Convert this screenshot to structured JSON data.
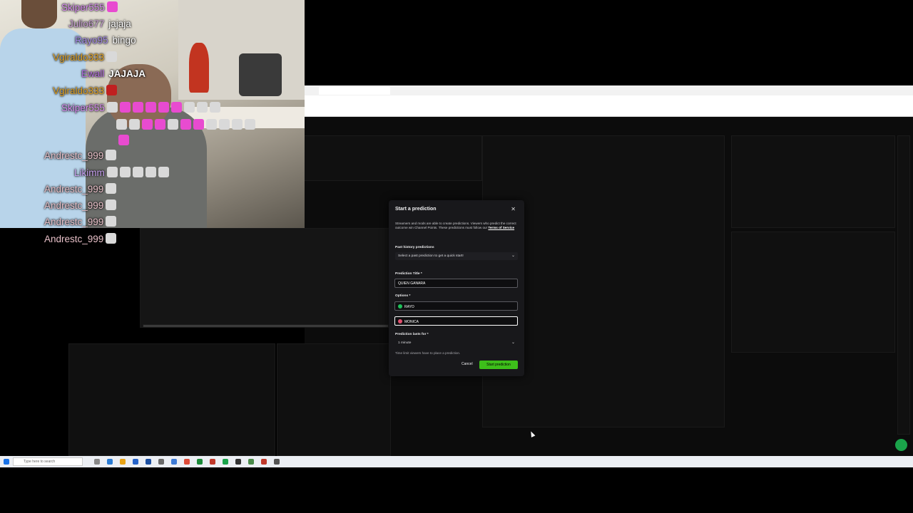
{
  "chat_overlay": [
    {
      "user": "Skiper555",
      "color": "#d88cf0",
      "message": "",
      "emotes": [
        "pink"
      ]
    },
    {
      "user": "Julio677",
      "color": "#c9a0d4",
      "message": "jajaja",
      "emotes": []
    },
    {
      "user": "Rayo95",
      "color": "#a58be8",
      "message": "bingo",
      "emotes": []
    },
    {
      "user": "Vgiraldo333",
      "color": "#e0a020",
      "message": "",
      "emotes": [
        "white"
      ]
    },
    {
      "user": "Ewall",
      "color": "#b46ee0",
      "message": "JAJAJA",
      "emotes": []
    },
    {
      "user": "Vgiraldo333",
      "color": "#e0a020",
      "message": "",
      "emotes": [
        "red"
      ]
    },
    {
      "user": "Skiper555",
      "color": "#d88cf0",
      "message": "",
      "emotes": [
        "pink",
        "white",
        "pink",
        "pink",
        "pink",
        "pink",
        "pink",
        "pink",
        "white",
        "white"
      ]
    },
    {
      "user": "Andrestc_999",
      "color": "#e8c0c8",
      "message": "",
      "emotes": [
        "white"
      ]
    },
    {
      "user": "Likimm",
      "color": "#c8a0f0",
      "message": "",
      "emotes": [
        "white",
        "white",
        "white",
        "white",
        "white"
      ]
    },
    {
      "user": "Andrestc_999",
      "color": "#e8c0c8",
      "message": "",
      "emotes": [
        "white"
      ]
    },
    {
      "user": "Andrestc_999",
      "color": "#e8c0c8",
      "message": "",
      "emotes": [
        "white"
      ]
    },
    {
      "user": "Andrestc_999",
      "color": "#e8c0c8",
      "message": "",
      "emotes": [
        "white"
      ]
    },
    {
      "user": "Andrestc_999",
      "color": "#e8c0c8",
      "message": "",
      "emotes": [
        "white"
      ]
    }
  ],
  "modal": {
    "title": "Start a prediction",
    "close_icon": "close-icon",
    "description": "Streamers and mods are able to create predictions. Viewers who predict the correct outcome win Channel Points. These predictions must follow our",
    "tos_link": "Terms of Service",
    "past_label": "Past history predictions",
    "past_placeholder": "Select a past prediction to get a quick start!",
    "title_label": "Prediction Title *",
    "title_value": "QUIEN GANARA",
    "options_label": "Options *",
    "option1": "RAYO",
    "option1_color": "#1ec25a",
    "option2": "MONICA",
    "option2_color": "#e0506e",
    "duration_label": "Prediction lasts for *",
    "duration_value": "1 minute",
    "duration_hint": "Time limit viewers have to place a prediction.",
    "cancel": "Cancel",
    "start": "Start prediction"
  },
  "taskbar": {
    "search_placeholder": "Type here to search"
  }
}
